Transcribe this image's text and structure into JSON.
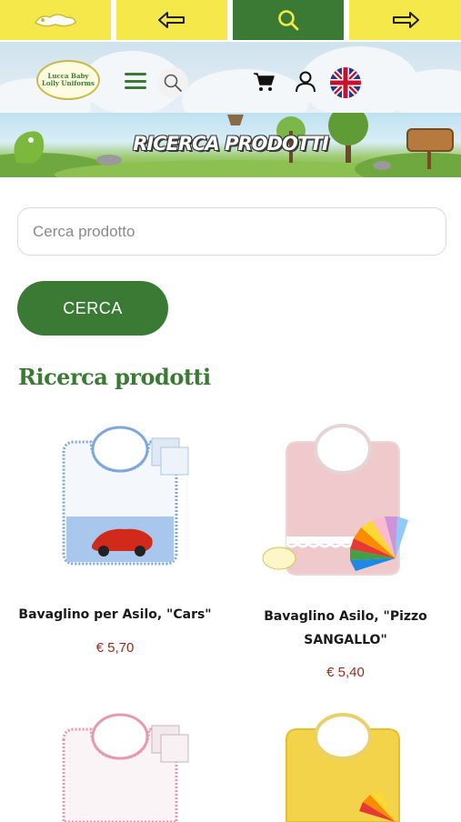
{
  "topnav": {
    "items": [
      {
        "icon": "home-logo-icon"
      },
      {
        "icon": "arrow-left-icon"
      },
      {
        "icon": "search-icon",
        "active": true
      },
      {
        "icon": "arrow-right-icon"
      }
    ]
  },
  "header": {
    "logo_text_line1": "Lucca Baby",
    "logo_text_line2": "Lolly Uniforms",
    "icons": [
      "menu-icon",
      "search-icon",
      "cart-icon",
      "user-icon",
      "uk-flag-icon"
    ]
  },
  "banner": {
    "title": "RICERCA PRODOTTI"
  },
  "search": {
    "placeholder": "Cerca prodotto",
    "value": "",
    "button_label": "CERCA"
  },
  "section_title": "Ricerca prodotti",
  "products": [
    {
      "name_line1": "Bavaglino per Asilo, \"Cars\"",
      "name_line2": "",
      "price": "€ 5,70"
    },
    {
      "name_line1": "Bavaglino Asilo, \"Pizzo",
      "name_line2": "SANGALLO\"",
      "price": "€ 5,40"
    },
    {
      "name_line1": "",
      "name_line2": "",
      "price": ""
    },
    {
      "name_line1": "",
      "name_line2": "",
      "price": ""
    }
  ],
  "colors": {
    "primary_green": "#3a7a34",
    "nav_yellow": "#f4e84a",
    "price_red": "#9b2b1e"
  }
}
